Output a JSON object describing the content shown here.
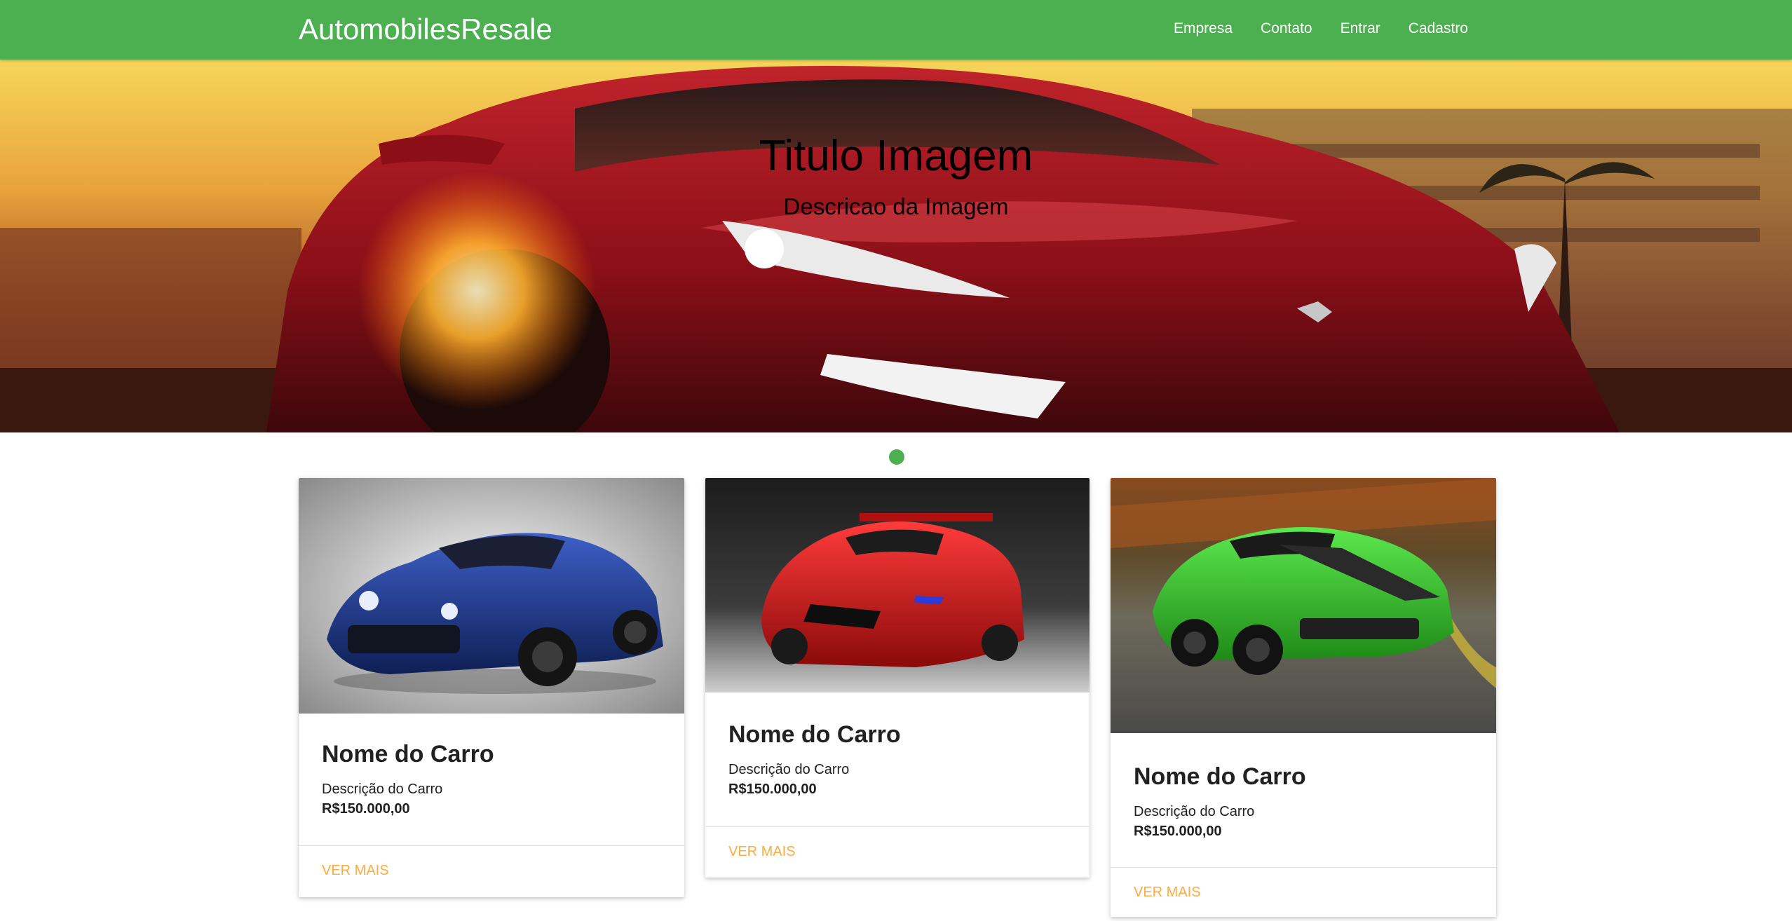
{
  "navbar": {
    "brand": "AutomobilesResale",
    "links": [
      "Empresa",
      "Contato",
      "Entrar",
      "Cadastro"
    ]
  },
  "slider": {
    "title": "Titulo Imagem",
    "description": "Descricao da Imagem",
    "active_slide": 1,
    "slide_count": 1
  },
  "cards": [
    {
      "name": "Nome do Carro",
      "description": "Descrição do Carro",
      "price": "R$150.000,00",
      "action": "VER MAIS",
      "car_color": "#1f3a8a"
    },
    {
      "name": "Nome do Carro",
      "description": "Descrição do Carro",
      "price": "R$150.000,00",
      "action": "VER MAIS",
      "car_color": "#d81b1b"
    },
    {
      "name": "Nome do Carro",
      "description": "Descrição do Carro",
      "price": "R$150.000,00",
      "action": "VER MAIS",
      "car_color": "#2fc42b"
    }
  ],
  "colors": {
    "primary": "#4caf50",
    "accent": "#ffab40",
    "text": "#212121"
  }
}
